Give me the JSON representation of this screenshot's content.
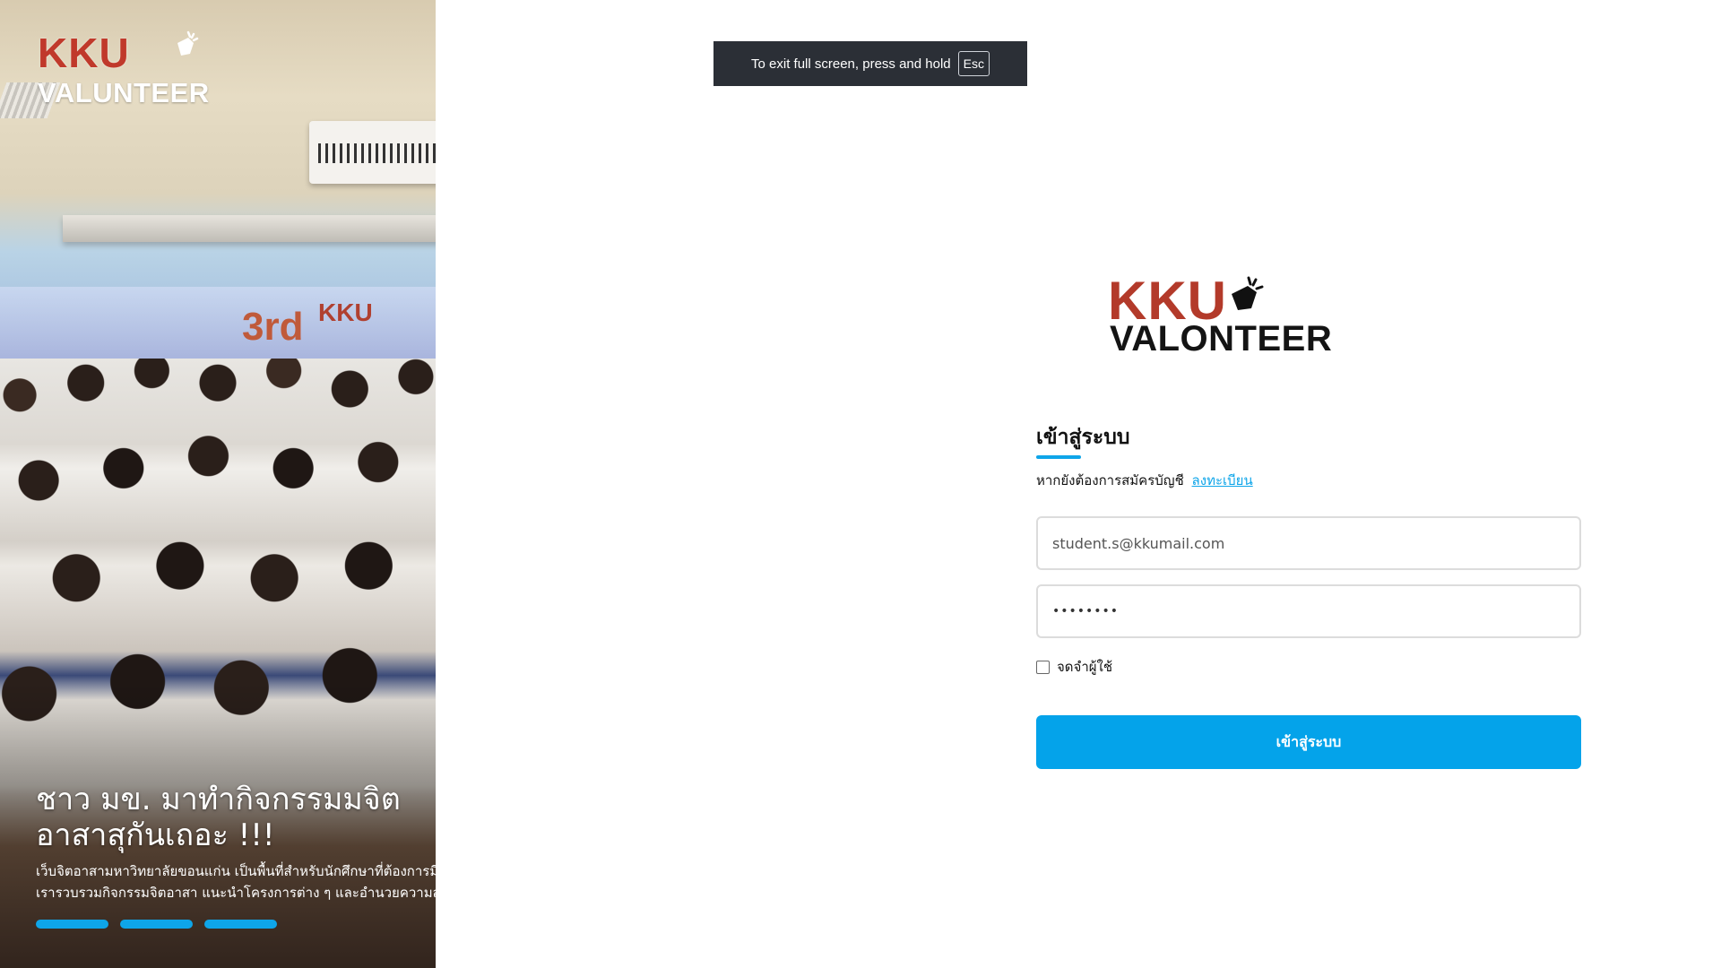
{
  "hero": {
    "logo_kku": "KKU",
    "logo_valunteer": "VALUNTEER",
    "banner_text_1": "3rd",
    "banner_text_2": "KKU",
    "headline": "ชาว มข. มาทำกิจกรรมมจิตอาสาสุกันเถอะ !!!",
    "description_line1": "เว็บจิตอาสามหาวิทยาลัยขอนแก่น เป็นพื้นที่สำหรับนักศึกษาที่ต้องการมีส่วนร่วมในการพัฒนาสังคมและชุมชน",
    "description_line2": "เรารวบรวมกิจกรรมจิตอาสา แนะนำโครงการต่าง ๆ และอำนวยความสะดวกในการบันทึกชั่วโมงจิตอาสา",
    "carousel_dots": 3
  },
  "fullscreen_notice": {
    "text": "To exit full screen, press and hold",
    "key": "Esc"
  },
  "brand": {
    "kku": "KKU",
    "valonteer": "VALONTEER"
  },
  "login": {
    "title": "เข้าสู่ระบบ",
    "signup_prompt": "หากยังต้องการสมัครบัญชี",
    "signup_link": "ลงทะเบียน",
    "email_value": "student.s@kkumail.com",
    "password_value": "••••••••",
    "remember_label": "จดจำผู้ใช้",
    "submit_label": "เข้าสู่ระบบ"
  },
  "colors": {
    "accent": "#04a3ea",
    "brand_red": "#b33a2a",
    "notice_bg": "#2b2f36"
  },
  "icons": {
    "logo_hand": "mini-heart-hand-icon"
  }
}
